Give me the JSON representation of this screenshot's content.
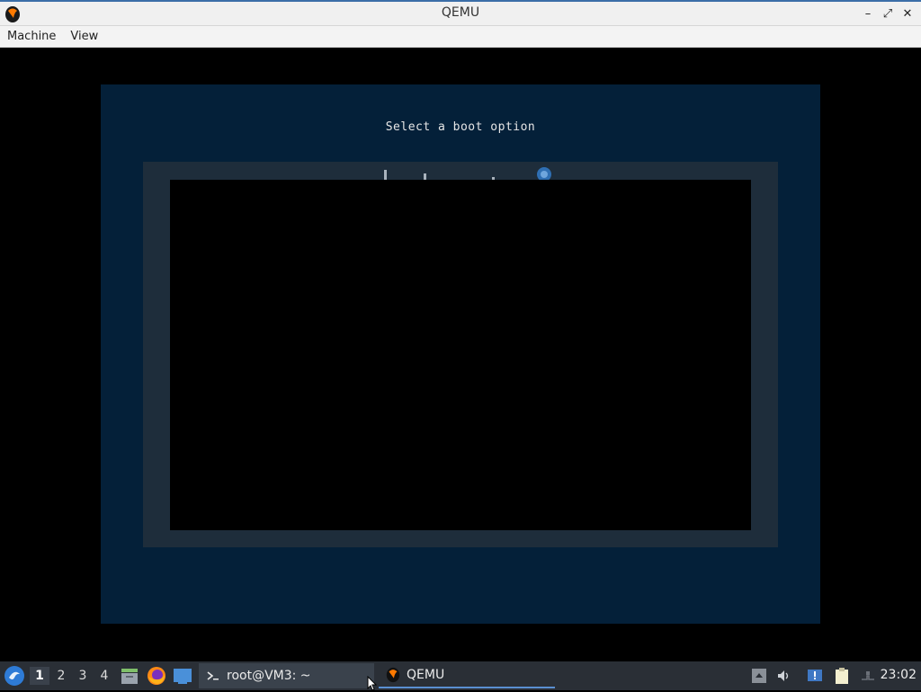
{
  "window": {
    "title": "QEMU",
    "controls": {
      "minimize": "–",
      "maximize": "⤢",
      "close": "✕"
    }
  },
  "menubar": {
    "items": [
      {
        "label": "Machine"
      },
      {
        "label": "View"
      }
    ]
  },
  "vm": {
    "boot_title": "Select a boot option"
  },
  "taskbar": {
    "workspaces": [
      {
        "label": "1"
      },
      {
        "label": "2"
      },
      {
        "label": "3"
      },
      {
        "label": "4"
      }
    ],
    "tasks": [
      {
        "label": "root@VM3: ~",
        "icon": "terminal-icon"
      },
      {
        "label": "QEMU",
        "icon": "qemu-icon"
      }
    ],
    "clock": "23:02"
  },
  "colors": {
    "boot_background": "#042039",
    "boot_frame": "#1e2d3b",
    "taskbar": "#2a2f36",
    "accent": "#5a8fd1"
  }
}
